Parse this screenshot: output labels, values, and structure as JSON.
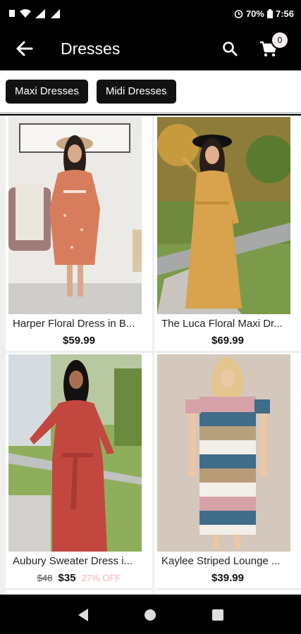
{
  "status_bar": {
    "battery": "70%",
    "time": "7:56"
  },
  "app_bar": {
    "title": "Dresses",
    "cart_count": "0"
  },
  "icons": {
    "back": "arrow-left-icon",
    "search": "search-icon",
    "cart": "cart-icon"
  },
  "chips": [
    {
      "label": "Maxi Dresses"
    },
    {
      "label": "Midi Dresses"
    }
  ],
  "products": [
    {
      "name": "Harper Floral Dress in B...",
      "price": "$59.99",
      "old_price": "",
      "discount": ""
    },
    {
      "name": "The Luca Floral Maxi Dr...",
      "price": "$69.99",
      "old_price": "",
      "discount": ""
    },
    {
      "name": "Aubury Sweater Dress i...",
      "price": "$35",
      "old_price": "$48",
      "discount": "27% OFF"
    },
    {
      "name": "Kaylee Striped Lounge ...",
      "price": "$39.99",
      "old_price": "",
      "discount": ""
    }
  ],
  "colors": {
    "app_bar": "#000000",
    "chip": "#111111",
    "background": "#efefef"
  }
}
